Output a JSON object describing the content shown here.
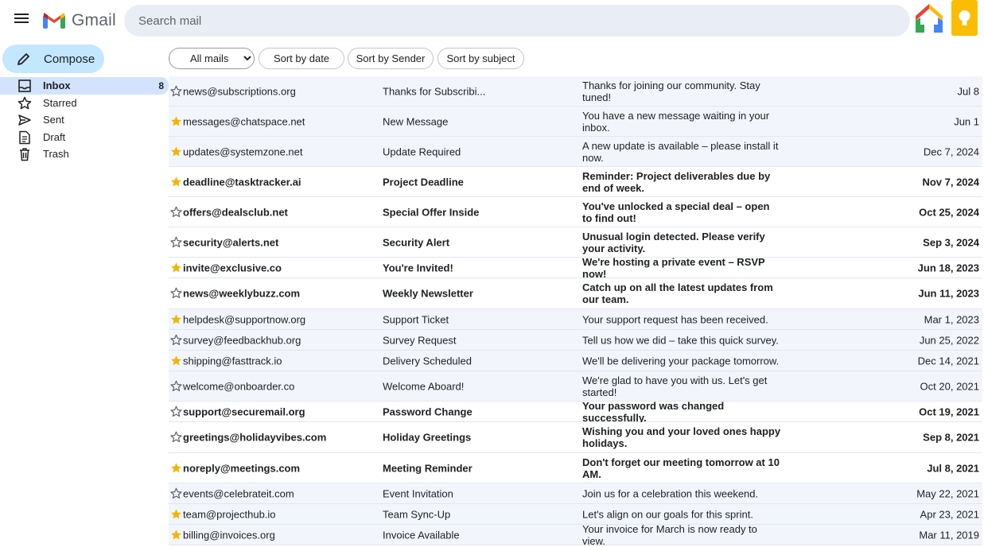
{
  "header": {
    "app_name": "Gmail",
    "search_placeholder": "Search mail"
  },
  "sidebar": {
    "compose_label": "Compose",
    "items": [
      {
        "label": "Inbox",
        "count": "8",
        "icon": "inbox-icon",
        "active": true
      },
      {
        "label": "Starred",
        "count": "",
        "icon": "star-icon",
        "active": false
      },
      {
        "label": "Sent",
        "count": "",
        "icon": "send-icon",
        "active": false
      },
      {
        "label": "Draft",
        "count": "",
        "icon": "draft-icon",
        "active": false
      },
      {
        "label": "Trash",
        "count": "",
        "icon": "trash-icon",
        "active": false
      }
    ]
  },
  "toolbar": {
    "filter_selected": "All mails",
    "sort_date": "Sort by date",
    "sort_sender": "Sort by Sender",
    "sort_subject": "Sort by subject"
  },
  "colors": {
    "accent": "#c2e7ff",
    "active_nav": "#d3e3fd",
    "read_row": "#f2f6fc",
    "star": "#f4b400"
  },
  "emails": [
    {
      "starred": false,
      "unread": false,
      "sender": "news@subscriptions.org",
      "subject": "Thanks for Subscribi...",
      "snippet": "Thanks for joining our community. Stay tuned!",
      "date": "Jul 8"
    },
    {
      "starred": true,
      "unread": false,
      "sender": "messages@chatspace.net",
      "subject": "New Message",
      "snippet": "You have a new message waiting in your inbox.",
      "date": "Jun 1"
    },
    {
      "starred": true,
      "unread": false,
      "sender": "updates@systemzone.net",
      "subject": "Update Required",
      "snippet": "A new update is available – please install it now.",
      "date": "Dec 7, 2024"
    },
    {
      "starred": true,
      "unread": true,
      "sender": "deadline@tasktracker.ai",
      "subject": "Project Deadline",
      "snippet": "Reminder: Project deliverables due by end of week.",
      "date": "Nov 7, 2024"
    },
    {
      "starred": false,
      "unread": true,
      "sender": "offers@dealsclub.net",
      "subject": "Special Offer Inside",
      "snippet": "You've unlocked a special deal – open to find out!",
      "date": "Oct 25, 2024"
    },
    {
      "starred": false,
      "unread": true,
      "sender": "security@alerts.net",
      "subject": "Security Alert",
      "snippet": "Unusual login detected. Please verify your activity.",
      "date": "Sep 3, 2024"
    },
    {
      "starred": true,
      "unread": true,
      "sender": "invite@exclusive.co",
      "subject": "You're Invited!",
      "snippet": "We're hosting a private event – RSVP now!",
      "date": "Jun 18, 2023"
    },
    {
      "starred": false,
      "unread": true,
      "sender": "news@weeklybuzz.com",
      "subject": "Weekly Newsletter",
      "snippet": "Catch up on all the latest updates from our team.",
      "date": "Jun 11, 2023"
    },
    {
      "starred": true,
      "unread": false,
      "sender": "helpdesk@supportnow.org",
      "subject": "Support Ticket",
      "snippet": "Your support request has been received.",
      "date": "Mar 1, 2023"
    },
    {
      "starred": false,
      "unread": false,
      "sender": "survey@feedbackhub.org",
      "subject": "Survey Request",
      "snippet": "Tell us how we did – take this quick survey.",
      "date": "Jun 25, 2022"
    },
    {
      "starred": true,
      "unread": false,
      "sender": "shipping@fasttrack.io",
      "subject": "Delivery Scheduled",
      "snippet": "We'll be delivering your package tomorrow.",
      "date": "Dec 14, 2021"
    },
    {
      "starred": false,
      "unread": false,
      "sender": "welcome@onboarder.co",
      "subject": "Welcome Aboard!",
      "snippet": "We're glad to have you with us. Let's get started!",
      "date": "Oct 20, 2021"
    },
    {
      "starred": false,
      "unread": true,
      "sender": "support@securemail.org",
      "subject": "Password Change",
      "snippet": "Your password was changed successfully.",
      "date": "Oct 19, 2021"
    },
    {
      "starred": false,
      "unread": true,
      "sender": "greetings@holidayvibes.com",
      "subject": "Holiday Greetings",
      "snippet": "Wishing you and your loved ones happy holidays.",
      "date": "Sep 8, 2021"
    },
    {
      "starred": true,
      "unread": true,
      "sender": "noreply@meetings.com",
      "subject": "Meeting Reminder",
      "snippet": "Don't forget our meeting tomorrow at 10 AM.",
      "date": "Jul 8, 2021"
    },
    {
      "starred": false,
      "unread": false,
      "sender": "events@celebrateit.com",
      "subject": "Event Invitation",
      "snippet": "Join us for a celebration this weekend.",
      "date": "May 22, 2021"
    },
    {
      "starred": true,
      "unread": false,
      "sender": "team@projecthub.io",
      "subject": "Team Sync-Up",
      "snippet": "Let's align on our goals for this sprint.",
      "date": "Apr 23, 2021"
    },
    {
      "starred": true,
      "unread": false,
      "sender": "billing@invoices.org",
      "subject": "Invoice Available",
      "snippet": "Your invoice for March is now ready to view.",
      "date": "Mar 11, 2019"
    }
  ]
}
